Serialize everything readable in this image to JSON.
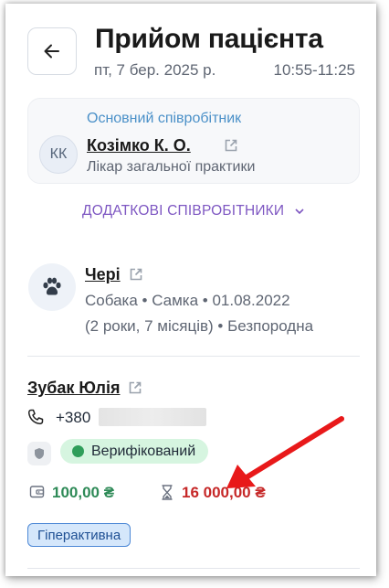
{
  "header": {
    "title": "Прийом пацієнта",
    "date": "пт, 7 бер. 2025 р.",
    "time": "10:55-11:25"
  },
  "staff": {
    "role": "Основний співробітник",
    "initials": "КК",
    "name": "Козімко К. О.",
    "position": "Лікар загальної практики"
  },
  "additional_staff_label": "ДОДАТКОВІ СПІВРОБІТНИКИ",
  "pet": {
    "name": "Чері",
    "details_line1": "Собака • Самка • 01.08.2022",
    "details_line2": "(2 роки, 7 місяців) • Безпородна"
  },
  "owner": {
    "name": "Зубак Юлія",
    "phone_prefix": "+380",
    "verification_label": "Верифікований",
    "balance": "100,00 ₴",
    "debt": "16 000,00 ₴",
    "tag": "Гіперактивна"
  },
  "colors": {
    "accent_purple": "#7e57c2",
    "role_blue": "#4a90c8",
    "balance_green": "#2e8a57",
    "debt_red": "#c62828",
    "annotation_arrow": "#e8191a"
  },
  "icons": [
    "back-arrow-icon",
    "external-link-icon",
    "chevron-down-icon",
    "paw-icon",
    "phone-icon",
    "shield-icon",
    "wallet-icon",
    "hourglass-icon"
  ]
}
